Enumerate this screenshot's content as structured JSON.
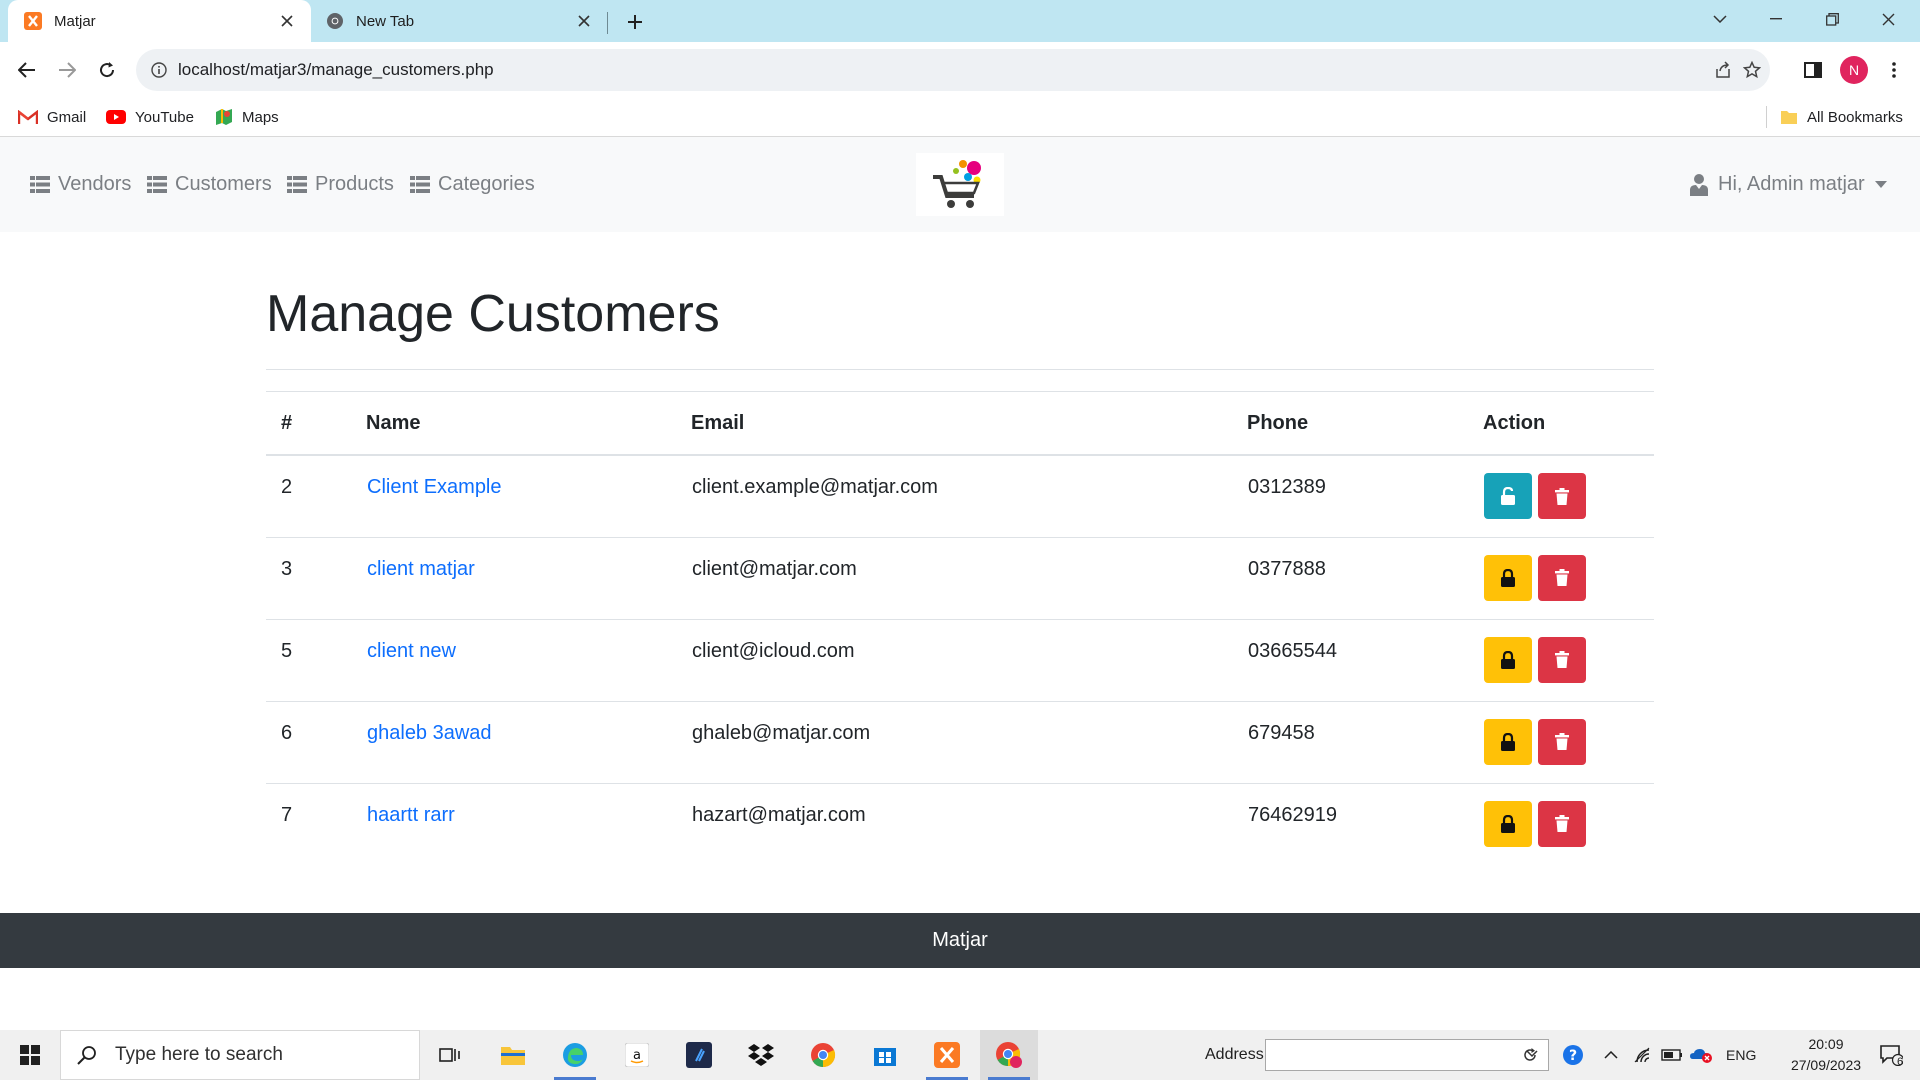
{
  "browser": {
    "tabs": [
      {
        "title": "Matjar",
        "active": true
      },
      {
        "title": "New Tab",
        "active": false
      }
    ],
    "url": "localhost/matjar3/manage_customers.php",
    "profile_initial": "N",
    "bookmarks": [
      {
        "label": "Gmail",
        "icon": "gmail-icon"
      },
      {
        "label": "YouTube",
        "icon": "youtube-icon"
      },
      {
        "label": "Maps",
        "icon": "maps-icon"
      }
    ],
    "all_bookmarks": "All Bookmarks"
  },
  "navbar": {
    "links": [
      {
        "label": "Vendors",
        "icon": "list-icon"
      },
      {
        "label": "Customers",
        "icon": "list-icon"
      },
      {
        "label": "Products",
        "icon": "list-icon"
      },
      {
        "label": "Categories",
        "icon": "list-icon"
      }
    ],
    "user_greeting": "Hi, Admin matjar"
  },
  "page": {
    "title": "Manage Customers",
    "table": {
      "columns": [
        "#",
        "Name",
        "Email",
        "Phone",
        "Action"
      ],
      "rows": [
        {
          "id": "2",
          "name": "Client Example",
          "email": "client.example@matjar.com",
          "phone": "0312389",
          "status": "unlocked"
        },
        {
          "id": "3",
          "name": "client matjar",
          "email": "client@matjar.com",
          "phone": "0377888",
          "status": "locked"
        },
        {
          "id": "5",
          "name": "client new",
          "email": "client@icloud.com",
          "phone": "03665544",
          "status": "locked"
        },
        {
          "id": "6",
          "name": "ghaleb 3awad",
          "email": "ghaleb@matjar.com",
          "phone": "679458",
          "status": "locked"
        },
        {
          "id": "7",
          "name": "haartt rarr",
          "email": "hazart@matjar.com",
          "phone": "76462919",
          "status": "locked"
        }
      ]
    }
  },
  "footer": {
    "text": "Matjar"
  },
  "taskbar": {
    "search_placeholder": "Type here to search",
    "address_label": "Address",
    "language": "ENG",
    "time": "20:09",
    "date": "27/09/2023",
    "notification_count": "6"
  },
  "colors": {
    "tab_strip": "#bfe6f2",
    "link": "#0d6efd",
    "unlock_button": "#17a2b8",
    "lock_button": "#ffc107",
    "delete_button": "#dc3545",
    "footer": "#343a40"
  }
}
